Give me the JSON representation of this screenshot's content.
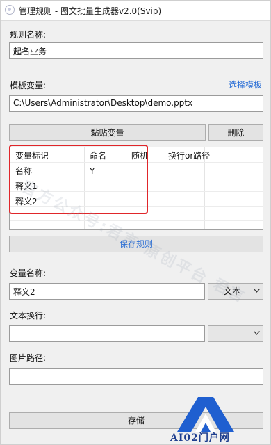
{
  "window": {
    "title": "管理规则 - 图文批量生成器v2.0(Svip)"
  },
  "rule_name": {
    "label": "规则名称:",
    "value": "起名业务"
  },
  "template_var": {
    "label": "模板变量:",
    "select_link": "选择模板",
    "path": "C:\\Users\\Administrator\\Desktop\\demo.pptx"
  },
  "buttons": {
    "paste_var": "黏贴变量",
    "delete": "删除",
    "save_rule": "保存规则",
    "save_bottom": "存储"
  },
  "table": {
    "columns": [
      "变量标识",
      "命名",
      "随机",
      "",
      "换行or路径"
    ],
    "rows": [
      [
        "名称",
        "Y",
        "",
        "",
        ""
      ],
      [
        "释义1",
        "",
        "",
        "",
        ""
      ],
      [
        "释义2",
        "",
        "",
        "",
        ""
      ]
    ]
  },
  "var_name": {
    "label": "变量名称:",
    "value": "释义2",
    "type_selected": "文本"
  },
  "text_wrap": {
    "label": "文本换行:",
    "value": "",
    "selected": ""
  },
  "image_path": {
    "label": "图片路径:",
    "value": ""
  },
  "watermark": "官方公众号:君言·原创平台 君言",
  "logo": {
    "text": "AI02门户网"
  },
  "colors": {
    "link": "#2b6fd6",
    "highlight": "#e0262a",
    "logo": "#1f5fd0"
  }
}
